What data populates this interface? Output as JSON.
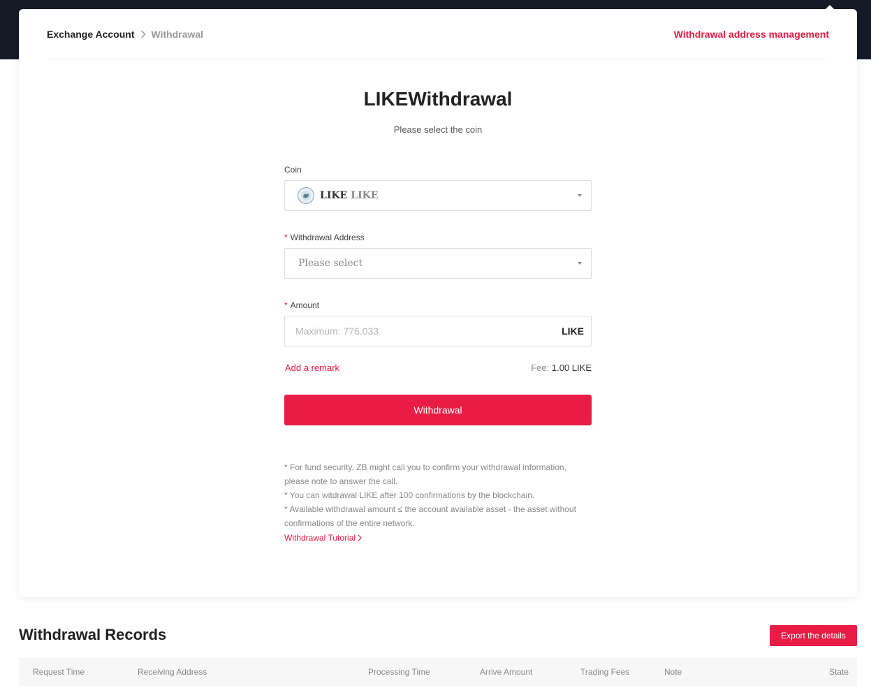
{
  "breadcrumb": {
    "parent": "Exchange Account",
    "current": "Withdrawal"
  },
  "header": {
    "address_management": "Withdrawal address management"
  },
  "title": "LIKEWithdrawal",
  "subtitle": "Please select the coin",
  "form": {
    "coin": {
      "label": "Coin",
      "symbol": "LIKE",
      "name": "LIKE",
      "icon": "like-coin-logo-icon"
    },
    "address": {
      "required": "*",
      "label": "Withdrawal Address",
      "placeholder": "Please select"
    },
    "amount": {
      "required": "*",
      "label": "Amount",
      "placeholder": "Maximum: 776.033",
      "unit": "LIKE"
    },
    "add_remark": "Add a remark",
    "fee_label": "Fee:",
    "fee_value": "1.00 LIKE",
    "submit": "Withdrawal"
  },
  "notes": [
    "* For fund security, ZB might call you to confirm your withdrawal information, please note to answer the call.",
    "* You can witdrawal LIKE after 100 confirmations by the blockchain.",
    "* Available withdrawal amount ≤ the account available asset - the asset without confirmations of the entire network."
  ],
  "tutorial_link": "Withdrawal Tutorial",
  "records": {
    "title": "Withdrawal Records",
    "export": "Export the details",
    "columns": [
      "Request Time",
      "Receiving Address",
      "Processing Time",
      "Arrive Amount",
      "Trading Fees",
      "Note",
      "State"
    ]
  },
  "colors": {
    "accent": "#e8183e",
    "top_band": "#161a26"
  }
}
